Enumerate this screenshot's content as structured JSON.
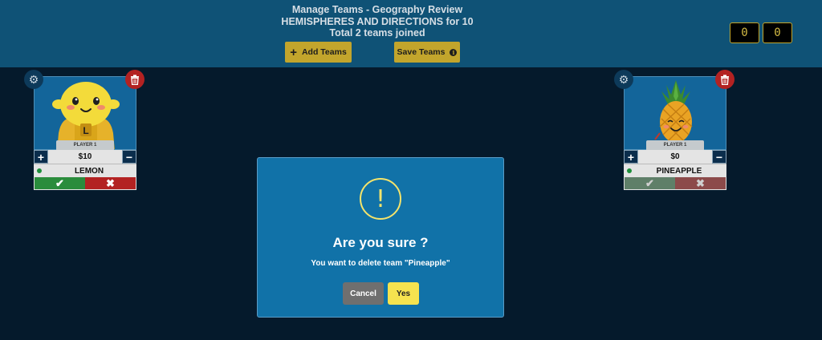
{
  "header": {
    "line1": "Manage Teams - Geography Review",
    "line2": "HEMISPHERES AND DIRECTIONS for 10",
    "line3": "Total 2 teams joined",
    "add_teams_label": "Add Teams",
    "save_teams_label": "Save Teams",
    "scores": [
      "0",
      "0"
    ]
  },
  "teams": [
    {
      "player_label": "PLAYER 1",
      "money": "$10",
      "name": "LEMON",
      "badge_letter": "L",
      "character_icon": "lemon-character-icon"
    },
    {
      "player_label": "PLAYER 1",
      "money": "$0",
      "name": "PINEAPPLE",
      "character_icon": "pineapple-character-icon"
    }
  ],
  "modal": {
    "icon": "!",
    "title": "Are you sure ?",
    "message": "You want to delete team \"Pineapple\"",
    "cancel_label": "Cancel",
    "yes_label": "Yes"
  },
  "colors": {
    "background": "#051a2c",
    "header": "#0f5276",
    "accent": "#c2a52c",
    "modal": "#1172a8",
    "warning": "#f5e46b",
    "danger": "#b32222",
    "success": "#2a8c3c"
  },
  "icons": {
    "add": "plus-icon",
    "save_info": "info-icon",
    "settings": "gear-icon",
    "delete": "trash-icon",
    "correct": "check-icon",
    "wrong": "x-icon",
    "alert": "exclamation-icon"
  }
}
